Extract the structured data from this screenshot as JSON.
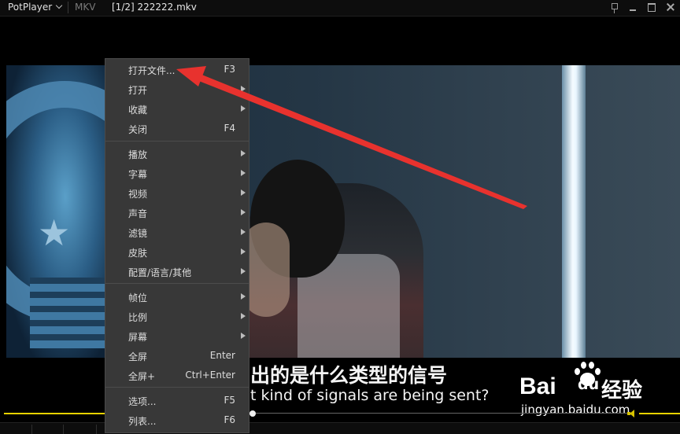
{
  "titlebar": {
    "app_name": "PotPlayer",
    "format": "MKV",
    "file_title": "[1/2] 222222.mkv"
  },
  "subtitles": {
    "chinese": "出的是什么类型的信号",
    "english": "t kind of signals are being sent?"
  },
  "menu": {
    "open_file": {
      "label": "打开文件...",
      "shortcut": "F3"
    },
    "open": {
      "label": "打开"
    },
    "favorites": {
      "label": "收藏"
    },
    "close": {
      "label": "关闭",
      "shortcut": "F4"
    },
    "playback": {
      "label": "播放"
    },
    "subtitle": {
      "label": "字幕"
    },
    "video": {
      "label": "视频"
    },
    "audio": {
      "label": "声音"
    },
    "filters": {
      "label": "滤镜"
    },
    "skin": {
      "label": "皮肤"
    },
    "config": {
      "label": "配置/语言/其他"
    },
    "frame": {
      "label": "帧位"
    },
    "ratio": {
      "label": "比例"
    },
    "screen": {
      "label": "屏幕"
    },
    "fullscreen": {
      "label": "全屏",
      "shortcut": "Enter"
    },
    "fullscreen_plus": {
      "label": "全屏+",
      "shortcut": "Ctrl+Enter"
    },
    "options": {
      "label": "选项...",
      "shortcut": "F5"
    },
    "playlist": {
      "label": "列表...",
      "shortcut": "F6"
    }
  },
  "watermark": {
    "brand_latin": "Bai",
    "brand_du": "du",
    "brand_cn": "经验",
    "url": "jingyan.baidu.com"
  },
  "colors": {
    "seek_accent": "#e8d200",
    "arrow": "#e8322e",
    "menu_bg": "#383838"
  },
  "icons": [
    "chevron-down-icon",
    "pin-icon",
    "minimize-icon",
    "maximize-icon",
    "close-icon",
    "submenu-arrow-icon",
    "volume-icon",
    "baidu-paw-icon"
  ]
}
